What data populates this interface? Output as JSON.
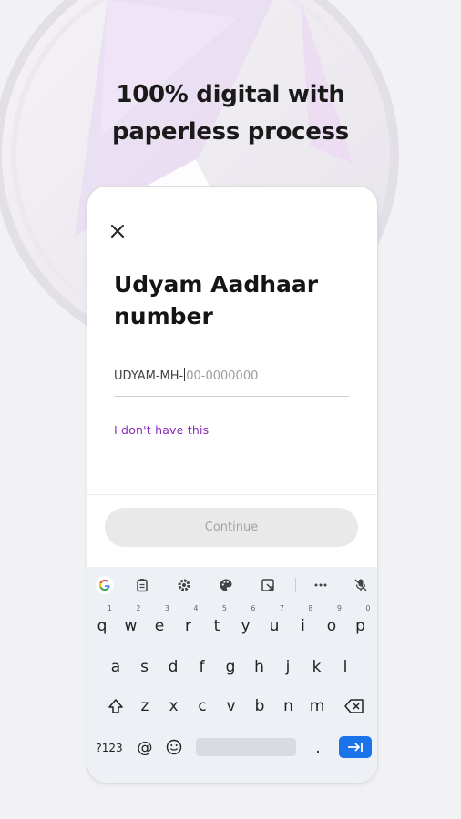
{
  "headline": {
    "line1": "100% digital with",
    "line2": "paperless process"
  },
  "form": {
    "title": "Udyam Aadhaar number",
    "field_prefix": "UDYAM-MH-",
    "field_placeholder": "00-0000000",
    "no_number_link": "I don't have this",
    "continue_label": "Continue"
  },
  "keyboard": {
    "toolbar_icons": [
      "google-icon",
      "clipboard-icon",
      "settings-icon",
      "palette-icon",
      "resize-icon",
      "more-icon",
      "mic-off-icon"
    ],
    "row1": [
      {
        "key": "q",
        "hint": "1"
      },
      {
        "key": "w",
        "hint": "2"
      },
      {
        "key": "e",
        "hint": "3"
      },
      {
        "key": "r",
        "hint": "4"
      },
      {
        "key": "t",
        "hint": "5"
      },
      {
        "key": "y",
        "hint": "6"
      },
      {
        "key": "u",
        "hint": "7"
      },
      {
        "key": "i",
        "hint": "8"
      },
      {
        "key": "o",
        "hint": "9"
      },
      {
        "key": "p",
        "hint": "0"
      }
    ],
    "row2": [
      "a",
      "s",
      "d",
      "f",
      "g",
      "h",
      "j",
      "k",
      "l"
    ],
    "row3": [
      "z",
      "x",
      "c",
      "v",
      "b",
      "n",
      "m"
    ],
    "symbols_key": "?123",
    "at_key": "@",
    "period_key": ".",
    "accent_color": "#1a73e8"
  },
  "colors": {
    "link": "#8a2dbb",
    "button_disabled_bg": "#e9e9e9"
  }
}
